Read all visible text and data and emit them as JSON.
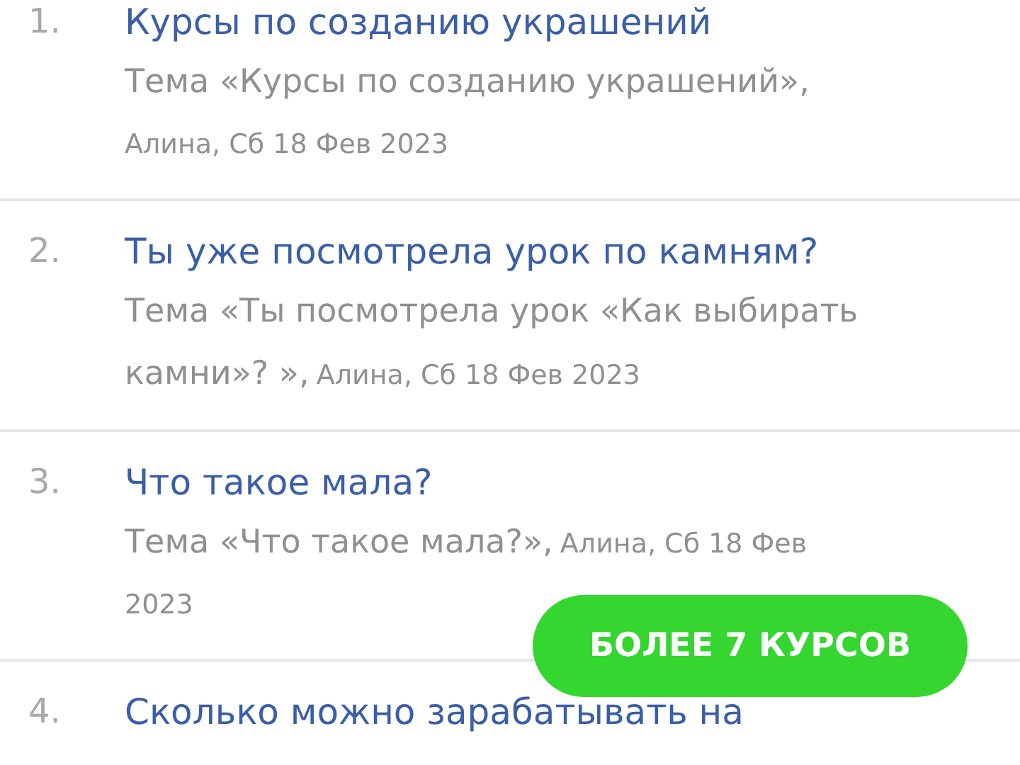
{
  "topics": [
    {
      "number": "1.",
      "title": "Курсы по созданию украшений",
      "topic": "Тема «Курсы по созданию украшений»,",
      "byline": "Алина, Сб 18 Фев 2023"
    },
    {
      "number": "2.",
      "title": "Ты уже посмотрела урок по камням?",
      "topic": "Тема «Ты посмотрела урок «Как выбирать камни»? »,",
      "byline": "Алина, Сб 18 Фев 2023"
    },
    {
      "number": "3.",
      "title": "Что такое мала?",
      "topic": "Тема «Что такое мала?»,",
      "byline": "Алина, Сб 18 Фев 2023"
    },
    {
      "number": "4.",
      "title": "Сколько можно зарабатывать на"
    }
  ],
  "promo_button": "БОЛЕЕ 7 КУРСОВ"
}
